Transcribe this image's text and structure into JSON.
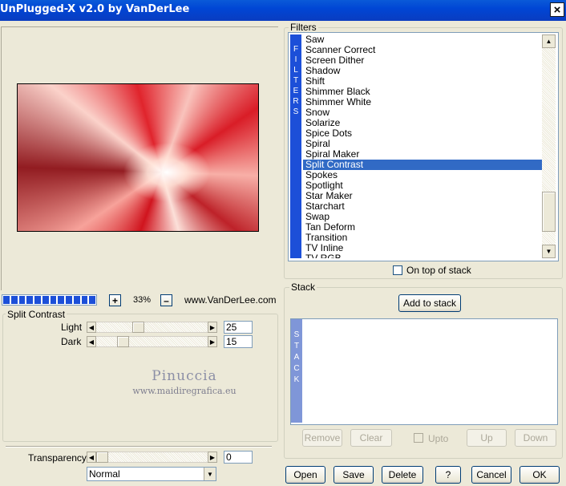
{
  "window": {
    "title": "UnPlugged-X v2.0 by VanDerLee",
    "close_glyph": "×"
  },
  "preview": {
    "zoom_minus": "–",
    "zoom_plus": "+",
    "zoom_value": "33%",
    "site": "www.VanDerLee.com",
    "progress_segments": 12
  },
  "params": {
    "group_title": "Split Contrast",
    "light": {
      "label": "Light",
      "value": "25"
    },
    "dark": {
      "label": "Dark",
      "value": "15"
    }
  },
  "watermark": {
    "name": "Pinuccia",
    "url": "www.maidiregrafica.eu"
  },
  "output": {
    "transparency": {
      "label": "Transparency",
      "value": "0"
    },
    "blend_mode": "Normal"
  },
  "filters": {
    "title": "Filters",
    "strip_letters": [
      "F",
      "I",
      "L",
      "T",
      "E",
      "R",
      "S"
    ],
    "items": [
      "Saw",
      "Scanner Correct",
      "Screen Dither",
      "Shadow",
      "Shift",
      "Shimmer Black",
      "Shimmer White",
      "Snow",
      "Solarize",
      "Spice Dots",
      "Spiral",
      "Spiral Maker",
      "Split Contrast",
      "Spokes",
      "Spotlight",
      "Star Maker",
      "Starchart",
      "Swap",
      "Tan Deform",
      "Transition",
      "TV Inline",
      "TV RGB"
    ],
    "selected": "Split Contrast",
    "on_top_label": "On top of stack"
  },
  "stack": {
    "title": "Stack",
    "add_label": "Add to stack",
    "strip_letters": [
      "S",
      "T",
      "A",
      "C",
      "K"
    ],
    "remove_label": "Remove",
    "clear_label": "Clear",
    "upto_label": "Upto",
    "up_label": "Up",
    "down_label": "Down"
  },
  "buttons": {
    "open": "Open",
    "save": "Save",
    "delete": "Delete",
    "help": "?",
    "cancel": "Cancel",
    "ok": "OK"
  }
}
